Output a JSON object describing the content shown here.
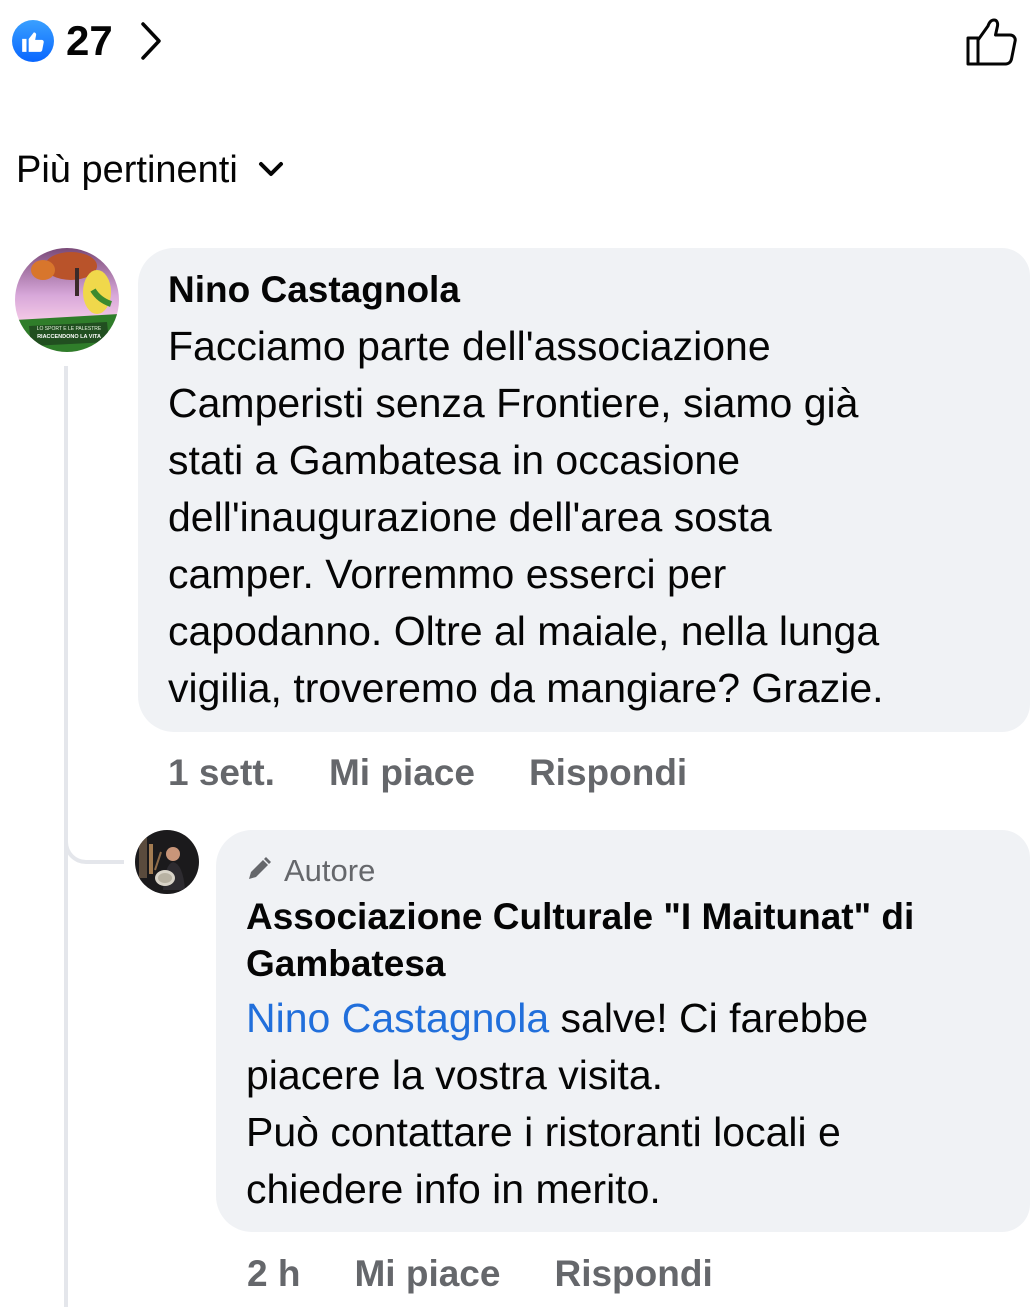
{
  "reactions": {
    "count": "27",
    "icon": "like-badge-icon",
    "accent_color": "#0866ff"
  },
  "sort": {
    "label": "Più pertinenti"
  },
  "comments": [
    {
      "author": "Nino Castagnola",
      "text": "Facciamo parte dell'associazione\nCamperisti senza Frontiere, siamo già\nstati a Gambatesa in occasione\ndell'inaugurazione dell'area sosta\ncamper. Vorremmo esserci per\ncapodanno. Oltre al maiale, nella lunga\nvigilia, troveremo da mangiare? Grazie.",
      "avatar_caption_1": "LO SPORT E LE PALESTRE",
      "avatar_caption_2": "RIACCENDONO LA VITA",
      "time": "1 sett.",
      "like_label": "Mi piace",
      "reply_label": "Rispondi"
    }
  ],
  "replies": [
    {
      "badge": "Autore",
      "author": "Associazione Culturale \"I Maitunat\" di Gambatesa",
      "mention": "Nino Castagnola",
      "text_after_mention": " salve! Ci farebbe\npiacere la vostra visita.\nPuò contattare i ristoranti locali e\nchiedere info in merito.",
      "time": "2 h",
      "like_label": "Mi piace",
      "reply_label": "Rispondi"
    }
  ],
  "colors": {
    "bubble": "#f0f2f5",
    "secondary_text": "#65676b",
    "mention": "#216fdb"
  }
}
